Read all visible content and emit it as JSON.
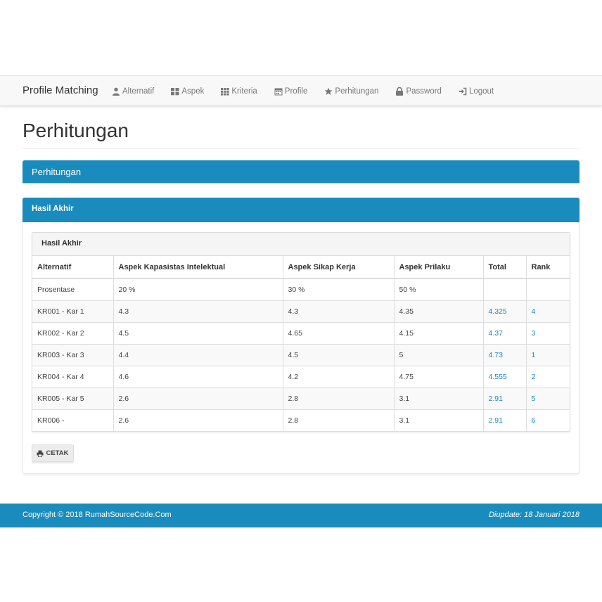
{
  "navbar": {
    "brand": "Profile Matching",
    "items": [
      {
        "label": "Alternatif",
        "icon": "user-icon"
      },
      {
        "label": "Aspek",
        "icon": "th-large-icon"
      },
      {
        "label": "Kriteria",
        "icon": "th-icon"
      },
      {
        "label": "Profile",
        "icon": "calendar-icon"
      },
      {
        "label": "Perhitungan",
        "icon": "star-icon"
      },
      {
        "label": "Password",
        "icon": "lock-icon"
      },
      {
        "label": "Logout",
        "icon": "log-in-icon"
      }
    ]
  },
  "page": {
    "title": "Perhitungan",
    "panel1_title": "Perhitungan",
    "panel2_title": "Hasil Akhir",
    "inner_title": "Hasil Akhir",
    "cetak_label": "CETAK"
  },
  "table": {
    "headers": [
      "Alternatif",
      "Aspek Kapasistas Intelektual",
      "Aspek Sikap Kerja",
      "Aspek Prilaku",
      "Total",
      "Rank"
    ],
    "rows": [
      [
        "Prosentase",
        "20 %",
        "30 %",
        "50 %",
        "",
        ""
      ],
      [
        "KR001 - Kar 1",
        "4.3",
        "4.3",
        "4.35",
        "4.325",
        "4"
      ],
      [
        "KR002 - Kar 2",
        "4.5",
        "4.65",
        "4.15",
        "4.37",
        "3"
      ],
      [
        "KR003 - Kar 3",
        "4.4",
        "4.5",
        "5",
        "4.73",
        "1"
      ],
      [
        "KR004 - Kar 4",
        "4.6",
        "4.2",
        "4.75",
        "4.555",
        "2"
      ],
      [
        "KR005 - Kar 5",
        "2.6",
        "2.8",
        "3.1",
        "2.91",
        "5"
      ],
      [
        "KR006 -",
        "2.6",
        "2.8",
        "3.1",
        "2.91",
        "6"
      ]
    ]
  },
  "footer": {
    "copyright": "Copyright © 2018 RumahSourceCode.Com",
    "updated": "Diupdate: 18 Januari 2018"
  },
  "colors": {
    "primary": "#1a8bbd",
    "navbar_bg": "#f8f8f8",
    "link": "#1a8bbd"
  }
}
